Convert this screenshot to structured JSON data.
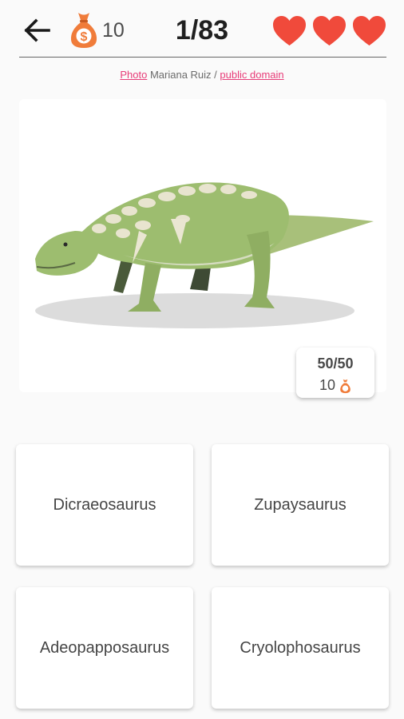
{
  "header": {
    "coins": "10",
    "progress": "1/83",
    "lives": 3,
    "icons": {
      "back": "arrow-left-icon",
      "coins": "money-bag-icon",
      "life": "heart-icon"
    },
    "colors": {
      "heart": "#f04a3b",
      "bag": "#f07c3a"
    }
  },
  "credit": {
    "photo_link": "Photo",
    "author": "Mariana Ruiz",
    "separator": "/",
    "license_link": "public domain"
  },
  "badge": {
    "score": "50/50",
    "reward": "10"
  },
  "answers": [
    {
      "label": "Dicraeosaurus"
    },
    {
      "label": "Zupaysaurus"
    },
    {
      "label": "Adeopapposaurus"
    },
    {
      "label": "Cryolophosaurus"
    }
  ]
}
